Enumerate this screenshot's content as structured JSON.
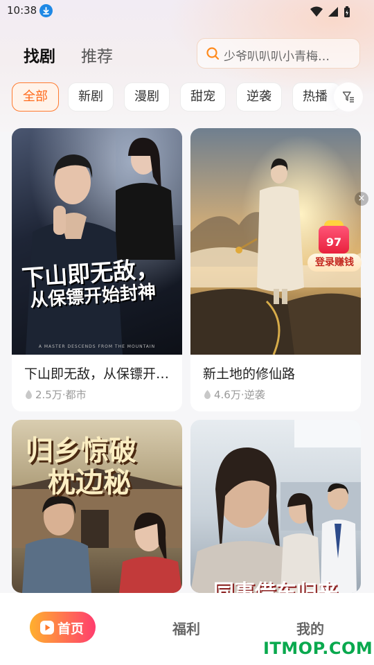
{
  "status_bar": {
    "time": "10:38"
  },
  "header": {
    "tabs": [
      {
        "label": "找剧",
        "active": true
      },
      {
        "label": "推荐",
        "active": false
      }
    ],
    "search": {
      "placeholder": "少爷叭叭叭小青梅…",
      "icon": "search-icon"
    }
  },
  "categories": [
    {
      "label": "全部",
      "active": true
    },
    {
      "label": "新剧"
    },
    {
      "label": "漫剧"
    },
    {
      "label": "甜宠"
    },
    {
      "label": "逆袭"
    },
    {
      "label": "热播"
    }
  ],
  "cards": [
    {
      "title": "下山即无敌，从保镖开始封神",
      "views": "2.5万",
      "genre": "都市",
      "poster_text_1": "下山即无敌，",
      "poster_text_2": "从保镖开始封神",
      "poster_caption": "A MASTER DESCENDS FROM THE MOUNTAIN"
    },
    {
      "title": "新土地的修仙路",
      "views": "4.6万",
      "genre": "逆袭"
    },
    {
      "title": "",
      "poster_text_1": "归乡惊破",
      "poster_text_2": "枕边秘"
    },
    {
      "title": "",
      "poster_text_1": "同事借车归来"
    }
  ],
  "reward": {
    "amount": "97",
    "label": "登录赚钱",
    "close": "×"
  },
  "bottom_nav": {
    "items": [
      {
        "label": "首页",
        "active": true
      },
      {
        "label": "福利"
      },
      {
        "label": "我的"
      }
    ]
  },
  "watermark": "ITMOP.COM",
  "colors": {
    "accent": "#ff6a1a",
    "nav_gradient_start": "#ffb02e",
    "nav_gradient_end": "#ff3d6e",
    "watermark": "#0aa94e"
  }
}
